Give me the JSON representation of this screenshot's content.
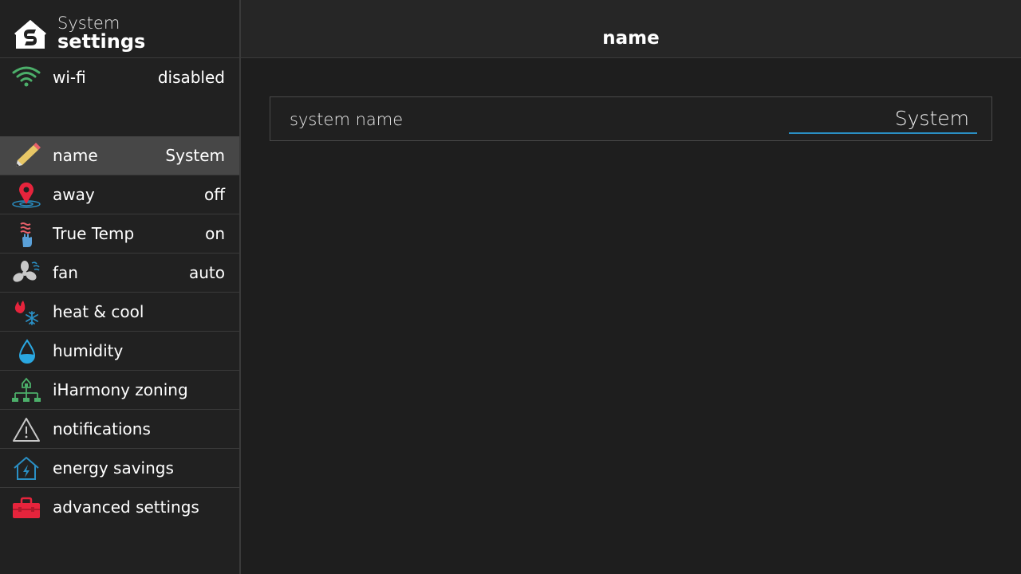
{
  "brand": {
    "line1": "System",
    "line2": "settings",
    "icon": "home-logo-icon"
  },
  "header": {
    "title": "name"
  },
  "sidebar": {
    "wifi": {
      "label": "wi-fi",
      "value": "disabled",
      "icon": "wifi-icon"
    },
    "items": [
      {
        "label": "name",
        "value": "System",
        "icon": "pencil-icon",
        "active": true
      },
      {
        "label": "away",
        "value": "off",
        "icon": "location-pin-icon"
      },
      {
        "label": "True Temp",
        "value": "on",
        "icon": "true-temp-icon"
      },
      {
        "label": "fan",
        "value": "auto",
        "icon": "fan-icon"
      },
      {
        "label": "heat & cool",
        "value": "",
        "icon": "flame-snowflake-icon"
      },
      {
        "label": "humidity",
        "value": "",
        "icon": "water-drop-icon"
      },
      {
        "label": "iHarmony zoning",
        "value": "",
        "icon": "zoning-tree-icon"
      },
      {
        "label": "notifications",
        "value": "",
        "icon": "warning-triangle-icon"
      },
      {
        "label": "energy savings",
        "value": "",
        "icon": "energy-home-icon"
      },
      {
        "label": "advanced settings",
        "value": "",
        "icon": "toolbox-icon"
      }
    ]
  },
  "main": {
    "field": {
      "label": "system name",
      "value": "System"
    }
  },
  "colors": {
    "accent": "#2a8fc4",
    "active_row": "#474747",
    "background": "#1e1e1e"
  }
}
